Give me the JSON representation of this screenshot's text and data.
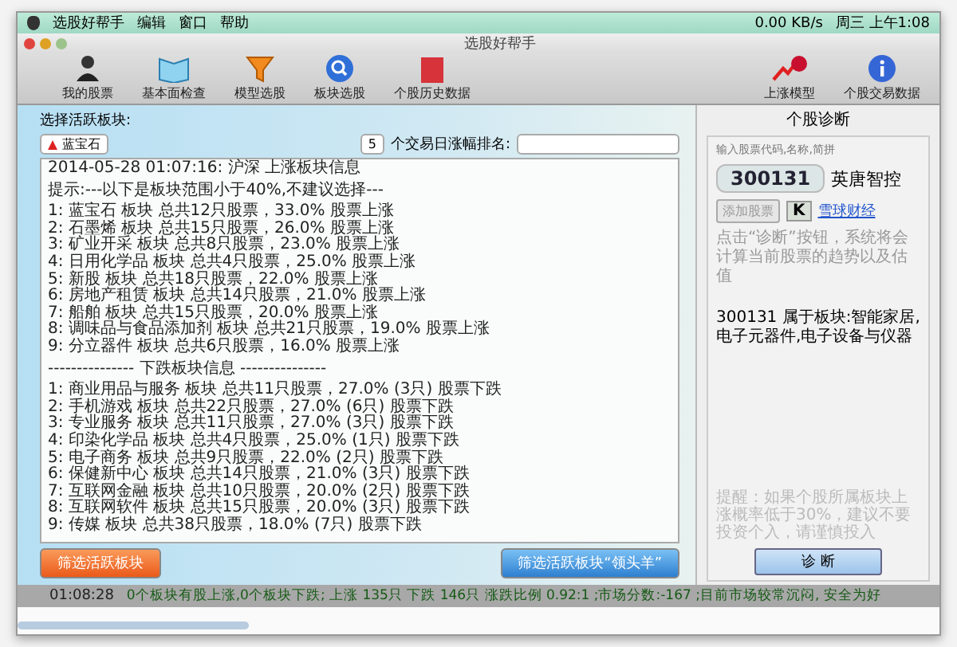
{
  "menu_bar": {
    "app": "选股好帮手",
    "menus": [
      "编辑",
      "窗口",
      "帮助"
    ],
    "network": "0.00 KB/s",
    "clock": "周三 上午1:08"
  },
  "window": {
    "title": "选股好帮手"
  },
  "toolbar": {
    "left": [
      "我的股票",
      "基本面检查",
      "模型选股",
      "板块选股",
      "个股历史数据"
    ],
    "right": [
      "上涨模型",
      "个股交易数据"
    ]
  },
  "left_panel": {
    "label": "选择活跃板块:",
    "sector_select": "蓝宝石",
    "days_select": "5",
    "days_label": "个交易日涨幅排名:",
    "report": {
      "heading": "2014-05-28 01:07:16:  沪深 上涨板块信息",
      "tip": "提示:---以下是板块范围小于40%,不建议选择---",
      "rising": [
        "1: 蓝宝石 板块 总共12只股票，33.0% 股票上涨",
        "2: 石墨烯 板块 总共15只股票，26.0% 股票上涨",
        "3: 矿业开采 板块 总共8只股票，23.0% 股票上涨",
        "4: 日用化学品 板块 总共4只股票，25.0% 股票上涨",
        "5: 新股 板块 总共18只股票，22.0% 股票上涨",
        "6: 房地产租赁 板块 总共14只股票，21.0% 股票上涨",
        "7: 船舶 板块 总共15只股票，20.0% 股票上涨",
        "8: 调味品与食品添加剂 板块 总共21只股票，19.0% 股票上涨",
        "9: 分立器件 板块 总共6只股票，16.0% 股票上涨"
      ],
      "falling_heading": "---------------  下跌板块信息  ---------------",
      "falling": [
        "1: 商业用品与服务 板块 总共11只股票，27.0% (3只) 股票下跌",
        "2: 手机游戏 板块 总共22只股票，27.0% (6只) 股票下跌",
        "3: 专业服务 板块 总共11只股票，27.0% (3只) 股票下跌",
        "4: 印染化学品 板块 总共4只股票，25.0% (1只) 股票下跌",
        "5: 电子商务 板块 总共9只股票，22.0% (2只) 股票下跌",
        "6: 保健新中心 板块 总共14只股票，21.0% (3只) 股票下跌",
        "7: 互联网金融 板块 总共10只股票，20.0% (2只) 股票下跌",
        "8: 互联网软件 板块 总共15只股票，20.0% (3只) 股票下跌",
        "9: 传媒 板块 总共38只股票，18.0% (7只) 股票下跌"
      ]
    },
    "buttons": [
      {
        "label": "筛选活跃板块",
        "kind": "orange"
      },
      {
        "label": "筛选活跃板块“领头羊”",
        "kind": "blue"
      }
    ]
  },
  "right_panel": {
    "title": "个股诊断",
    "input_hint": "输入股票代码,名称,简拼",
    "code": "300131",
    "name": "英唐智控",
    "add_button": "添加股票",
    "k_button": "K",
    "link": "雪球财经",
    "description": "点击“诊断”按钮，系统将会计算当前股票的趋势以及估值",
    "sectors_info": "300131 属于板块:智能家居,电子元器件,电子设备与仪器",
    "notice": "提醒：如果个股所属板块上涨概率低于30%，建议不要投资个入，请谨慎投入",
    "diagnose_button": "诊 断"
  },
  "status_bar": {
    "time": "01:08:28",
    "message": "0个板块有股上涨,0个板块下跌; 上涨 135只 下跌 146只 涨跌比例 0.92:1 ;市场分数:-167 ;目前市场较常沉闷, 安全为好"
  }
}
